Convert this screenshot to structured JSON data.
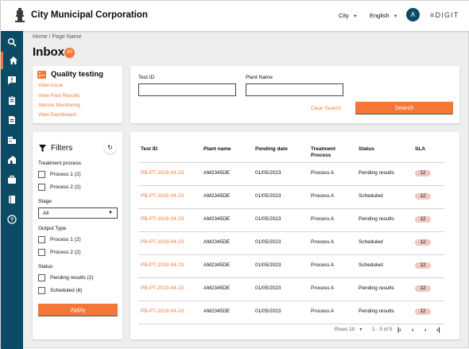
{
  "header": {
    "title": "City Municipal Corporation",
    "city_label": "City",
    "language_label": "English",
    "avatar_initial": "A",
    "logo_text": "≡DIGIT"
  },
  "sidebar": {
    "items": [
      {
        "icon": "search-icon"
      },
      {
        "icon": "home-icon"
      },
      {
        "icon": "alert-icon"
      },
      {
        "icon": "clipboard-icon"
      },
      {
        "icon": "document-icon"
      },
      {
        "icon": "building-icon"
      },
      {
        "icon": "house-icon"
      },
      {
        "icon": "briefcase-icon"
      },
      {
        "icon": "book-icon"
      },
      {
        "icon": "help-icon"
      }
    ]
  },
  "breadcrumb": "Home / Page Name",
  "page": {
    "title": "Inbox",
    "count": "43"
  },
  "quality": {
    "title": "Quality testing",
    "links": [
      "View Issue",
      "View Past Results",
      "Sensor Monitoring",
      "View Dashboard"
    ]
  },
  "search": {
    "test_id_label": "Test ID",
    "plant_name_label": "Plant Name",
    "test_id_value": "",
    "plant_name_value": "",
    "clear_label": "Clear Search",
    "search_label": "Search"
  },
  "filters": {
    "title": "Filters",
    "refresh_icon": "↻",
    "treatment_label": "Treatment process",
    "treatment_options": [
      "Process 1 (2)",
      "Process 2 (2)"
    ],
    "stage_label": "Stage",
    "stage_value": "All",
    "output_label": "Output Type",
    "output_options": [
      "Process 1 (2)",
      "Process 2 (2)"
    ],
    "status_label": "Status",
    "status_options": [
      "Pending results (2)",
      "Scheduled (6)"
    ],
    "apply_label": "Apply"
  },
  "table": {
    "headers": {
      "test_id": "Test ID",
      "plant_name": "Plant name",
      "pending_date": "Pending date",
      "treatment_1": "Treatment",
      "treatment_2": "Process",
      "status": "Status",
      "sla": "SLA"
    },
    "rows": [
      {
        "test_id": "PB-PT-2019-04-23",
        "plant": "AM2345DE",
        "date": "01/05/2023",
        "process": "Process A",
        "status": "Pending results",
        "sla": "12"
      },
      {
        "test_id": "PB-PT-2019-04-23",
        "plant": "AM2345DE",
        "date": "01/05/2023",
        "process": "Process A",
        "status": "Scheduled",
        "sla": "12"
      },
      {
        "test_id": "PB-PT-2019-04-23",
        "plant": "AM2345DE",
        "date": "01/05/2023",
        "process": "Process A",
        "status": "Pending results",
        "sla": "12"
      },
      {
        "test_id": "PB-PT-2019-04-23",
        "plant": "AM2345DE",
        "date": "01/05/2023",
        "process": "Process A",
        "status": "Scheduled",
        "sla": "12"
      },
      {
        "test_id": "PB-PT-2019-04-23",
        "plant": "AM2345DE",
        "date": "01/05/2023",
        "process": "Process A",
        "status": "Scheduled",
        "sla": "12"
      },
      {
        "test_id": "PB-PT-2019-04-23",
        "plant": "AM2345DE",
        "date": "01/05/2023",
        "process": "Process A",
        "status": "Pending results",
        "sla": "12"
      },
      {
        "test_id": "PB-PT-2019-04-23",
        "plant": "AM2345DE",
        "date": "01/05/2023",
        "process": "Process A",
        "status": "Pending results",
        "sla": "12"
      }
    ],
    "pagination": {
      "rows_label": "Rows",
      "rows_value": "10",
      "range": "1 - 5 of 5",
      "first": "|‹",
      "prev": "‹",
      "next": "›",
      "last": "›|"
    }
  },
  "colors": {
    "accent": "#f47738",
    "sidebar": "#0b4b66",
    "sla_badge": "#efc7c1"
  }
}
